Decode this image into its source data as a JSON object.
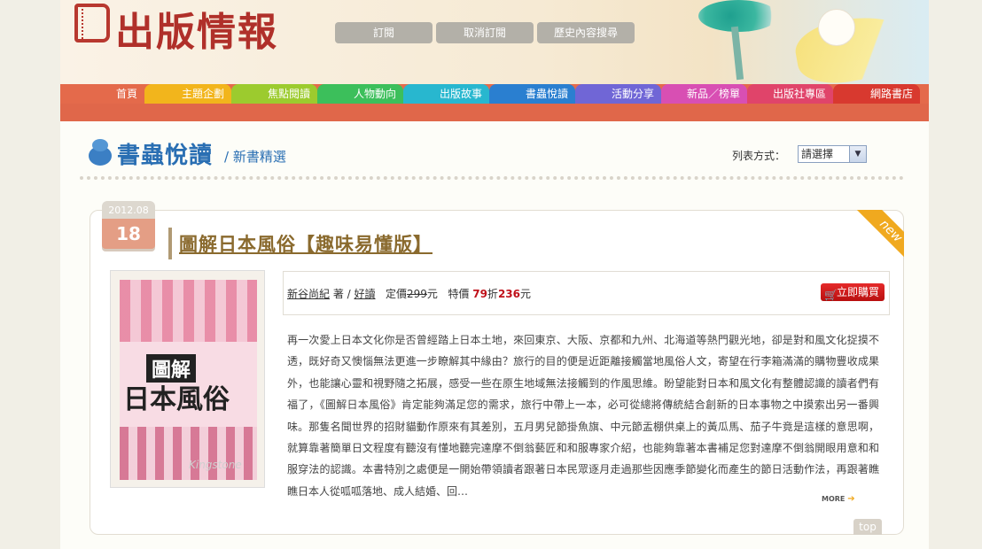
{
  "site": {
    "logo_text": "出版情報"
  },
  "top_buttons": [
    "訂閱",
    "取消訂閱",
    "歷史內容搜尋"
  ],
  "nav": {
    "items": [
      {
        "label": "首頁",
        "color": "#e46a4b"
      },
      {
        "label": "主題企劃",
        "color": "#f2b51c"
      },
      {
        "label": "焦點閱讀",
        "color": "#9ccb2e"
      },
      {
        "label": "人物動向",
        "color": "#3cbf5b"
      },
      {
        "label": "出版故事",
        "color": "#28b7cf"
      },
      {
        "label": "書蟲悅讀",
        "color": "#2a7fd0"
      },
      {
        "label": "活動分享",
        "color": "#7066d6"
      },
      {
        "label": "新品／榜單",
        "color": "#d84fb3"
      },
      {
        "label": "出版社專區",
        "color": "#e0446a"
      },
      {
        "label": "網路書店",
        "color": "#d8392f"
      }
    ]
  },
  "section": {
    "title": "書蟲悅讀",
    "subtitle": "/ 新書精選",
    "sort_label": "列表方式：",
    "sort_value": "請選擇"
  },
  "article": {
    "date_ym": "2012.08",
    "date_day": "18",
    "title": "圖解日本風俗【趣味易懂版】",
    "badge": "new",
    "author": "新谷尚紀",
    "author_suffix": " 著 / ",
    "publisher": "好讀",
    "list_price_label": "定價",
    "list_price": "299",
    "list_price_unit": "元",
    "special_label": "特價",
    "discount": "79",
    "discount_unit": "折",
    "special_price": "236",
    "special_unit": "元",
    "buy_label": "立即購買",
    "cover": {
      "small_title": "圖解",
      "big_title": "日本風俗",
      "watermark": "Kingstone"
    },
    "description": "再一次愛上日本文化你是否曾經踏上日本土地，來回東京、大阪、京都和九州、北海道等熱門觀光地，卻是對和風文化捉摸不透，既好奇又懊惱無法更進一步瞭解其中緣由？旅行的目的便是近距離接觸當地風俗人文，寄望在行李箱滿滿的購物豐收成果外，也能讓心靈和視野隨之拓展，感受一些在原生地域無法接觸到的作風思維。盼望能對日本和風文化有整體認識的讀者們有福了，《圖解日本風俗》肯定能夠滿足您的需求，旅行中帶上一本，必可從總將傳統結合創新的日本事物之中摸索出另一番興味。那隻名聞世界的招財貓動作原來有其差別，五月男兒節掛魚旗、中元節盂棚供桌上的黃瓜馬、茄子牛竟是這樣的意思啊，就算靠著簡單日文程度有聽沒有懂地聽完達摩不倒翁藝匠和和服專家介紹，也能夠靠著本書補足您對達摩不倒翁開眼用意和和服穿法的認識。本書特別之處便是一開始帶領讀者跟著日本民眾逐月走過那些因應季節變化而產生的節日活動作法，再跟著瞧瞧日本人從呱呱落地、成人結婚、回…",
    "more_label": "MORE",
    "top_label": "top"
  }
}
